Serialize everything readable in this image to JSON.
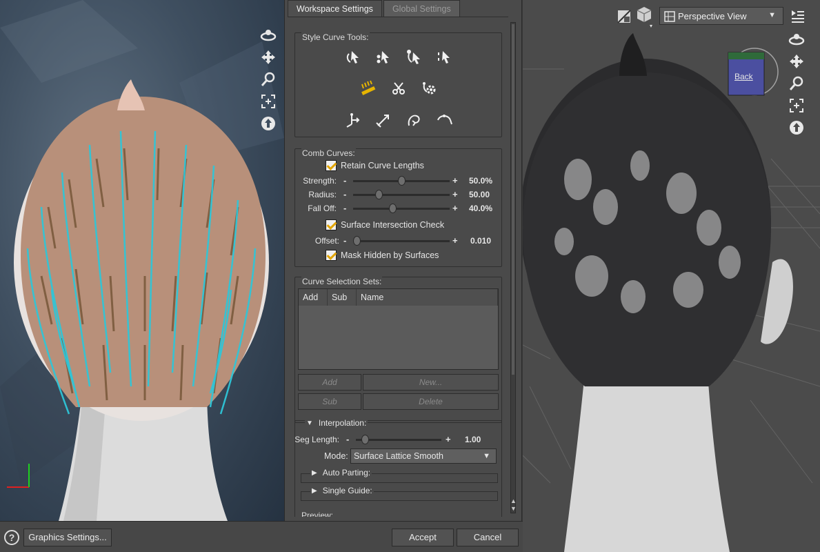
{
  "dialog": {
    "tabs": [
      {
        "label": "Workspace Settings",
        "active": true
      },
      {
        "label": "Global Settings",
        "active": false
      }
    ],
    "style_curve_tools": {
      "title": "Style Curve Tools:",
      "tools": [
        "select-curve-icon",
        "select-point-icon",
        "select-root-icon",
        "select-tip-icon",
        "comb-icon",
        "scissors-icon",
        "gear-settings-icon",
        "move-point-icon",
        "extend-icon",
        "curl-icon",
        "arc-icon"
      ]
    },
    "comb_curves": {
      "title": "Comb Curves:",
      "retain_lengths": {
        "label": "Retain Curve Lengths",
        "checked": true
      },
      "sliders": [
        {
          "label": "Strength:",
          "value": "50.0%",
          "fraction": 0.5
        },
        {
          "label": "Radius:",
          "value": "50.00",
          "fraction": 0.25
        },
        {
          "label": "Fall Off:",
          "value": "40.0%",
          "fraction": 0.4
        }
      ],
      "surface_check": {
        "label": "Surface Intersection Check",
        "checked": true
      },
      "offset": {
        "label": "Offset:",
        "value": "0.010",
        "fraction": 0.0
      },
      "mask_hidden": {
        "label": "Mask Hidden by Surfaces",
        "checked": true
      }
    },
    "selection_sets": {
      "title": "Curve Selection Sets:",
      "columns": [
        "Add",
        "Sub",
        "Name"
      ],
      "buttons": {
        "add": "Add",
        "new": "New...",
        "sub": "Sub",
        "delete": "Delete"
      }
    },
    "interpolation": {
      "title": "Interpolation:",
      "seg_length": {
        "label": "Seg Length:",
        "value": "1.00",
        "fraction": 0.07
      },
      "mode": {
        "label": "Mode:",
        "value": "Surface Lattice Smooth"
      },
      "auto_parting": "Auto Parting:",
      "single_guide": "Single Guide:",
      "preview": "Preview:"
    }
  },
  "viewport_right": {
    "view_mode": "Perspective View",
    "cube_face": "Back"
  },
  "bottom": {
    "help": "?",
    "graphics_settings": "Graphics Settings...",
    "accept": "Accept",
    "cancel": "Cancel"
  },
  "colors": {
    "accent_check": "#e1a400",
    "guide_curves": "#2ec6d8",
    "hair_brown": "#7a5a3c"
  }
}
